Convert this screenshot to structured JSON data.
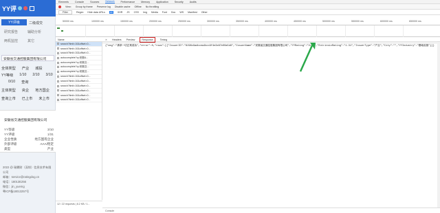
{
  "sidebar": {
    "logo": "YY评",
    "nav": [
      "YY评级",
      "二级成交",
      "研究报告",
      "辅助分析",
      "两机监控",
      "其它"
    ],
    "search_value": "安徽省交通控股集团有限公司",
    "filter_rows": [
      [
        "全体类型",
        "产业",
        "城投"
      ],
      [
        "YY等级",
        "1/10",
        "2/10",
        "3/10"
      ],
      [
        "",
        "0/10",
        "查询"
      ],
      [
        "主体类型",
        "央企",
        "地方国企"
      ],
      [
        "查询上市",
        "已上市",
        "未上市"
      ]
    ],
    "info_title": "安徽省交通控股集团有限公司",
    "info": [
      [
        "YY等级",
        "3/10"
      ],
      [
        "YY评级",
        "1/31"
      ],
      [
        "企业性质",
        "地方国有企业"
      ],
      [
        "外部评级",
        "AAA/稳定"
      ],
      [
        "类型",
        "产业"
      ]
    ],
    "footer": [
      "2022 @ 瑞霖财（深圳）信息技术有限公司",
      "邮箱：service@ratingdog.cn",
      "电话：18013E256",
      "微信：jin_yuemg",
      "粤ICP备18013257号"
    ]
  },
  "devtools": {
    "tabs": [
      "Elements",
      "Console",
      "Sources",
      "Network",
      "Performance",
      "Memory",
      "Application",
      "Security",
      "Audits"
    ],
    "active_tab": "Network",
    "toolbar1": [
      "View:",
      "Group by frame",
      "Preserve log",
      "Disable cache",
      "Offline",
      "No throttling"
    ],
    "toolbar2": [
      "Filter",
      "Regex",
      "Hide data URLs",
      "All",
      "XHR",
      "JS",
      "CSS",
      "Img",
      "Media",
      "Font",
      "Doc",
      "WS",
      "Manifest",
      "Other"
    ],
    "ruler": [
      "50000 ms",
      "100000 ms",
      "150000 ms",
      "200000 ms",
      "250000 ms",
      "300000 ms",
      "350000 ms",
      "400000 ms",
      "450000 ms",
      "500000 ms",
      "550000 ms",
      "600000 ms",
      "650000 ms"
    ],
    "name_header": "Name",
    "requests": [
      "search?limit=10&offset=0...",
      "search?limit=10&offset=0...",
      "search?limit=10&offset=0...",
      "autocomplete?q=安徽&...",
      "autocomplete?q=安徽交...",
      "autocomplete?q=安徽交...",
      "autocomplete?q=安徽交...",
      "search?limit=10&offset=0...",
      "search?limit=10&offset=0...",
      "search?limit=10&offset=0...",
      "search?limit=10&offset=0...",
      "search?limit=10&offset=0...",
      "search?limit=10&offset=0..."
    ],
    "sub_tabs": [
      "Headers",
      "Preview",
      "Response",
      "Timing"
    ],
    "response_text": "{\"msg\":\"请求一切正常成功\",\"error\":0,\"rows\":[{\"IssuerID\":\"8296c9adbcea4bcc9f4e3e87e00a5d9\",\"IssuerName\":\"安徽省交通控股集团有限公司\",\"YYRating\":\"3/10\",\"ExtrinsicRating\":\"1.31\",\"IssuerType\":\"产业\",\"City\":\"\",\"YYIndustry\":\"基础设施\"}]}",
    "status_text": "12 / 22 requests | 8.2 KB / 1...",
    "bottom_text": "Console"
  }
}
